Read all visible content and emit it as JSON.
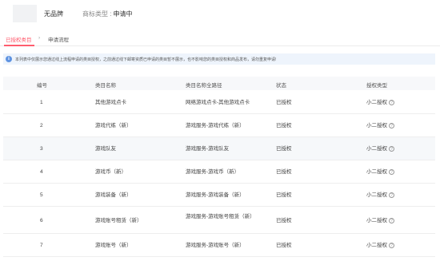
{
  "header": {
    "brand_name": "无品牌",
    "brand_type_label": "商标类型 :",
    "brand_type_value": "申请中"
  },
  "tabs": [
    {
      "label": "已授权类目",
      "active": true
    },
    {
      "label": "›",
      "active": false
    },
    {
      "label": "申请流程",
      "active": false
    }
  ],
  "notice": {
    "icon": "info-icon",
    "text": "本列表中仅展示您通过线上流程申请的类目授权，之前通过线下邮寄资质已申请的类目暂不展示，也不影响您的类目授权和商品发布，请勿重复申请!"
  },
  "table": {
    "columns": [
      "编号",
      "类目名称",
      "类目名称全路径",
      "状态",
      "授权类型"
    ],
    "rows": [
      {
        "num": "1",
        "name": "其他游戏点卡",
        "path": "网络游戏点卡-其他游戏点卡",
        "status": "已授权",
        "type": "小二授权"
      },
      {
        "num": "2",
        "name": "游戏代练（新）",
        "path": "游戏服务-游戏代练（新）",
        "status": "已授权",
        "type": "小二授权"
      },
      {
        "num": "3",
        "name": "游戏队友",
        "path": "游戏服务-游戏队友",
        "status": "已授权",
        "type": "小二授权"
      },
      {
        "num": "4",
        "name": "游戏币（新）",
        "path": "游戏服务-游戏币（新）",
        "status": "已授权",
        "type": "小二授权"
      },
      {
        "num": "5",
        "name": "游戏装备（新）",
        "path": "游戏服务-游戏装备（新）",
        "status": "已授权",
        "type": "小二授权"
      },
      {
        "num": "6",
        "name": "游戏账号租赁（新）",
        "path": "游戏服务-游戏账号租赁（新）",
        "status": "已授权",
        "type": "小二授权"
      },
      {
        "num": "7",
        "name": "游戏账号（新）",
        "path": "游戏服务-游戏账号（新）",
        "status": "已授权",
        "type": "小二授权"
      }
    ]
  },
  "colors": {
    "accent": "#ff5c6e",
    "notice_bg": "#eef4fc",
    "info_icon": "#5e93e1"
  }
}
